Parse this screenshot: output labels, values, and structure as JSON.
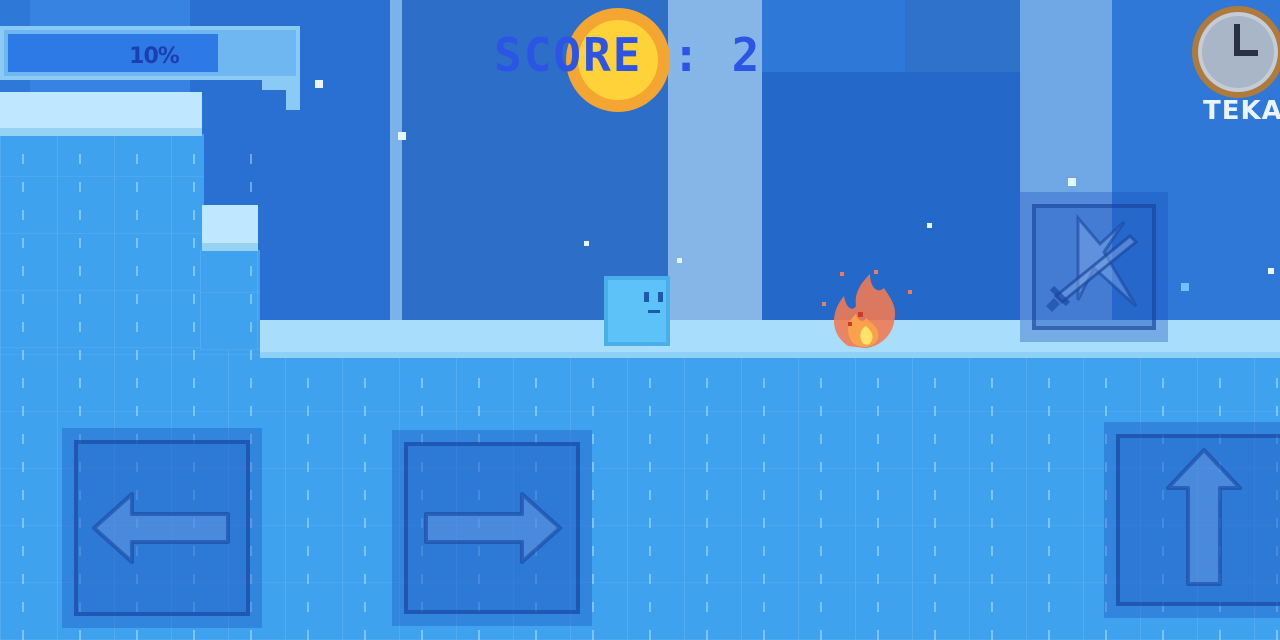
{
  "hud": {
    "progress": {
      "label": "10%",
      "value": 10
    },
    "score": {
      "label": "SCORE",
      "separator": ":",
      "value": "2"
    },
    "pause": {
      "icon": "clock-icon",
      "label": "TEKAN"
    }
  },
  "controls": {
    "left": {
      "icon": "arrow-left-icon"
    },
    "right": {
      "icon": "arrow-right-icon"
    },
    "jump": {
      "icon": "arrow-up-icon"
    },
    "attack": {
      "icon": "sword-icon"
    }
  },
  "entities": {
    "player": {
      "name": "ice-cube-player"
    },
    "enemy": {
      "name": "fire-enemy"
    }
  },
  "colors": {
    "sky": "#2e78d8",
    "ice": "#3fa2ef",
    "ice_top": "#a8defc",
    "sun": "#ffd23a",
    "score_text": "#2c55e6",
    "progress_fill": "#2d7ae6"
  }
}
